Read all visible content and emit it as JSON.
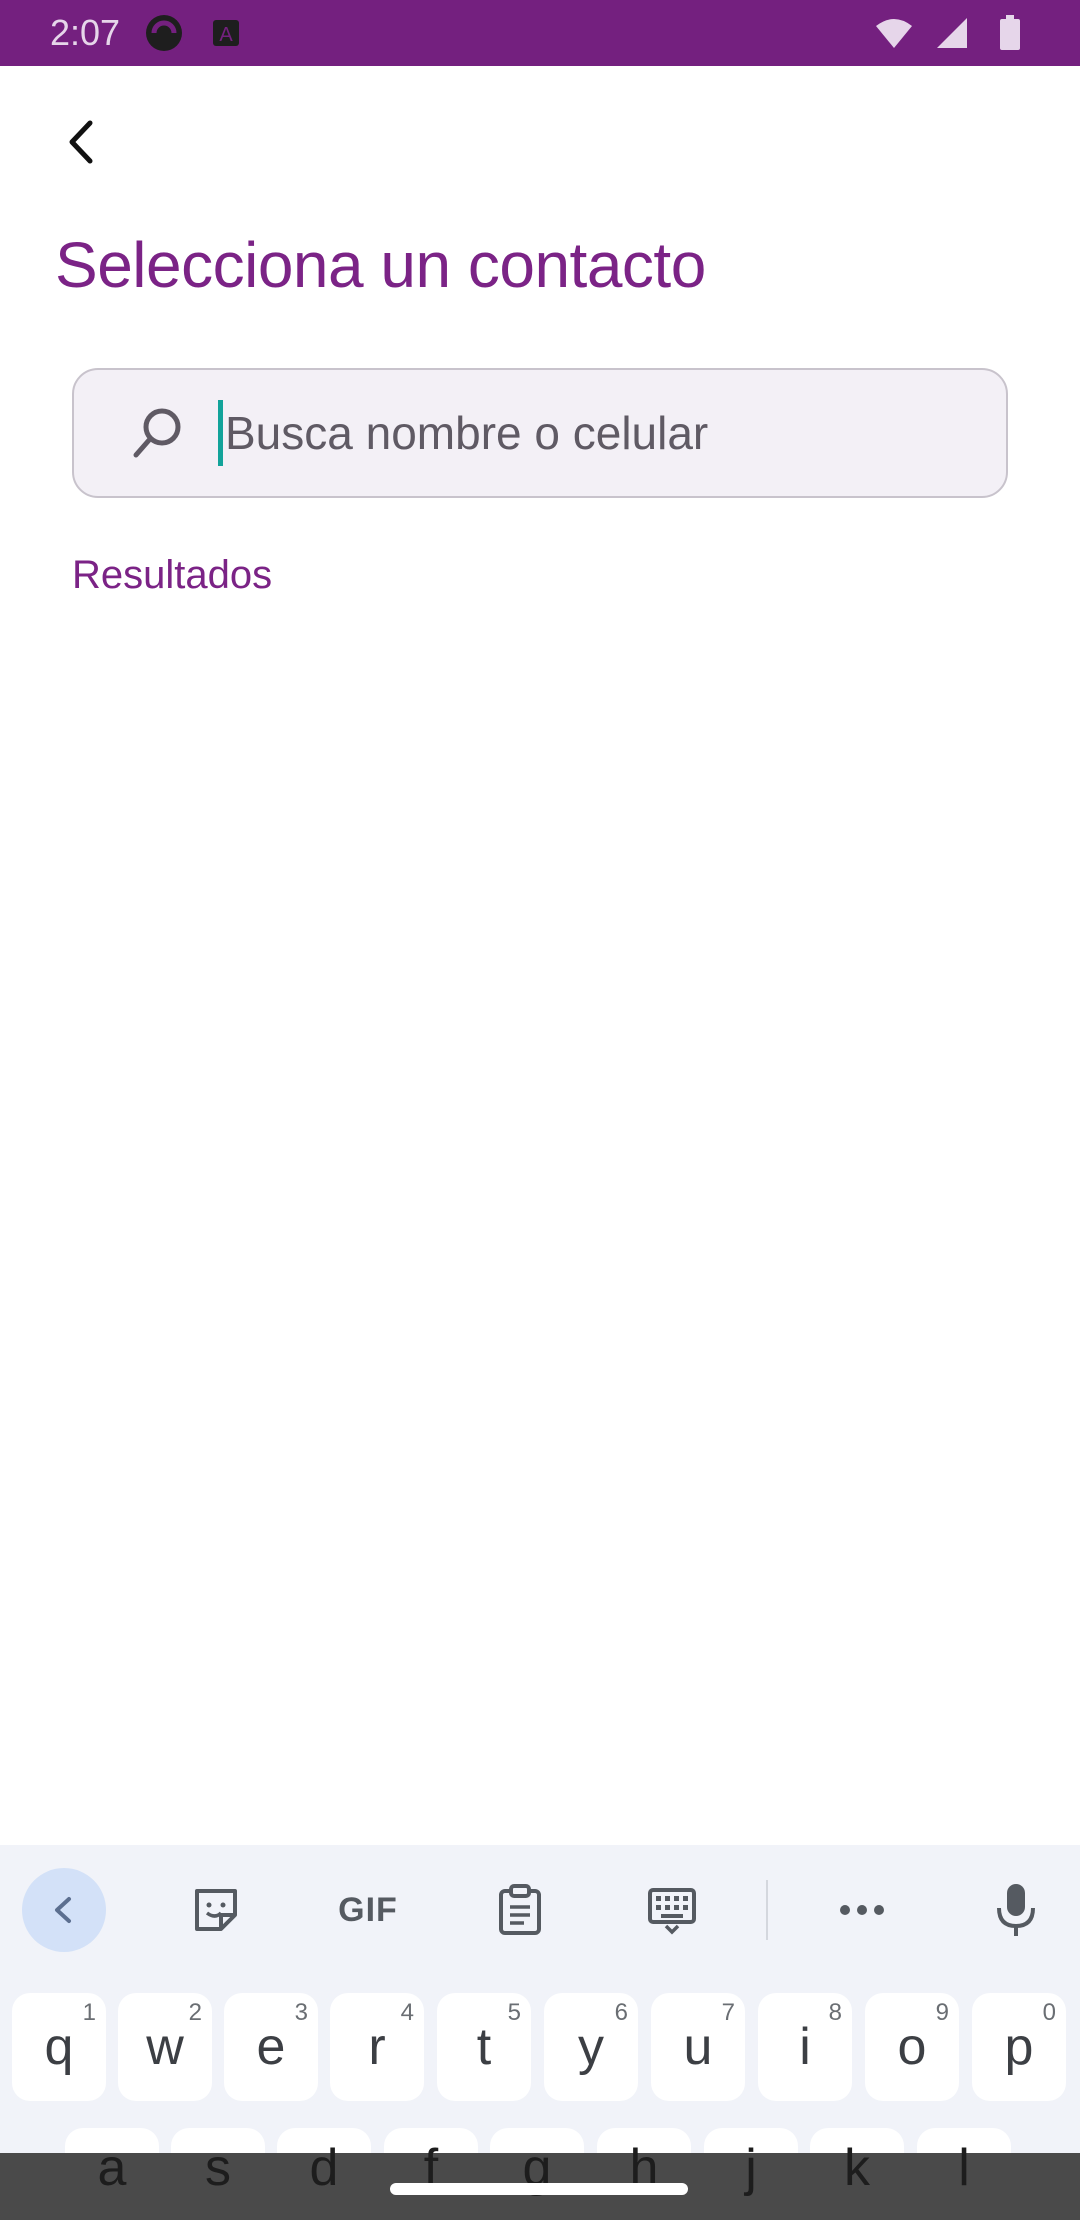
{
  "status_bar": {
    "time": "2:07",
    "left_icons": [
      "app-circle-icon",
      "text-a-icon"
    ],
    "right_icons": [
      "wifi-icon",
      "signal-icon",
      "battery-icon"
    ],
    "color": "#74207f"
  },
  "header": {
    "back_icon": "chevron-left-icon",
    "title": "Selecciona un contacto"
  },
  "search": {
    "placeholder": "Busca nombre o celular",
    "value": ""
  },
  "results": {
    "label": "Resultados",
    "items": []
  },
  "keyboard": {
    "toolbar": [
      "chevron-left-icon",
      "sticker-icon",
      "GIF",
      "clipboard-icon",
      "keyboard-icon",
      "more-icon",
      "mic-icon"
    ],
    "row1": [
      {
        "key": "q",
        "num": "1"
      },
      {
        "key": "w",
        "num": "2"
      },
      {
        "key": "e",
        "num": "3"
      },
      {
        "key": "r",
        "num": "4"
      },
      {
        "key": "t",
        "num": "5"
      },
      {
        "key": "y",
        "num": "6"
      },
      {
        "key": "u",
        "num": "7"
      },
      {
        "key": "i",
        "num": "8"
      },
      {
        "key": "o",
        "num": "9"
      },
      {
        "key": "p",
        "num": "0"
      }
    ],
    "row2": [
      "a",
      "s",
      "d",
      "f",
      "g",
      "h",
      "j",
      "k",
      "l"
    ]
  },
  "colors": {
    "accent": "#7b2386",
    "caret": "#12a39a"
  }
}
